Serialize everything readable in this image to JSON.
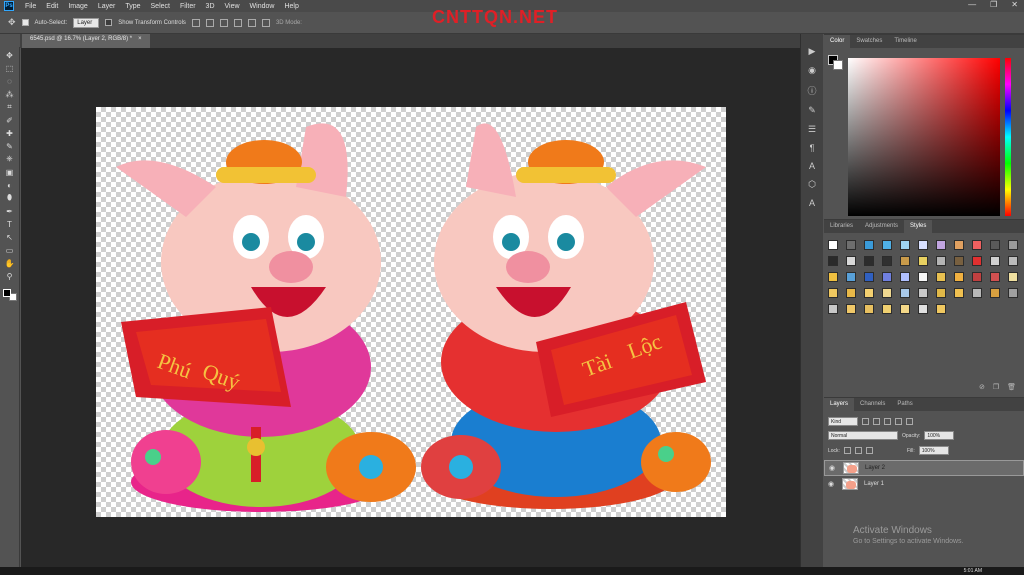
{
  "menu": {
    "logo": "Ps",
    "items": [
      "File",
      "Edit",
      "Image",
      "Layer",
      "Type",
      "Select",
      "Filter",
      "3D",
      "View",
      "Window",
      "Help"
    ],
    "window_controls": [
      "—",
      "❐",
      "✕"
    ]
  },
  "options": {
    "auto_select_label": "Auto-Select:",
    "auto_select_value": "Layer",
    "transform_label": "Show Transform Controls",
    "mode3d": "3D Mode:",
    "watermark": "CNTTQN.NET"
  },
  "doc": {
    "tab_title": "6545.psd @ 16.7% (Layer 2, RGB/8) *",
    "close": "×"
  },
  "tools": [
    "✥",
    "⬚",
    "◌",
    "⁂",
    "⌗",
    "✐",
    "✚",
    "✎",
    "⎈",
    "▣",
    "◐",
    "⬮",
    "✒",
    "T",
    "↖",
    "▭",
    "✋",
    "⚲"
  ],
  "color_panel": {
    "tabs": [
      "Color",
      "Swatches",
      "Timeline"
    ]
  },
  "styles_panel": {
    "tabs": [
      "Libraries",
      "Adjustments",
      "Styles"
    ],
    "swatches": [
      "#ffffff",
      "#6e6e6e",
      "#3a9ad8",
      "#4fb0e6",
      "#9fd3f0",
      "#d8e0ff",
      "#c1a5e0",
      "#e0a060",
      "#f06060",
      "#5a5a5a",
      "#9a9a9a",
      "#2a2a2a",
      "#d8d8d8",
      "#2c2c2c",
      "#303030",
      "#c89a4a",
      "#e8d060",
      "#b4b4b4",
      "#786040",
      "#e03030",
      "#d0d0d0",
      "#bbbbbb",
      "#f0c040",
      "#58a0d8",
      "#3060c0",
      "#7080e0",
      "#b0c0ff",
      "#f6f6f6",
      "#e8c050",
      "#f0b040",
      "#c04040",
      "#d05050",
      "#f0e0a0",
      "#f0c860",
      "#e8b848",
      "#f4d070",
      "#f0d890",
      "#a8c8e8",
      "#c8c8c8",
      "#e0b848",
      "#f0c050",
      "#b8b8b8",
      "#d8a040",
      "#a0a0a0",
      "#c8c8c8",
      "#f0c868",
      "#e8c060",
      "#f0d070",
      "#f4d888",
      "#e0e0e0",
      "#f0c860"
    ]
  },
  "layers_panel": {
    "tabs": [
      "Layers",
      "Channels",
      "Paths"
    ],
    "filter": "Kind",
    "blend_mode": "Normal",
    "opacity_label": "Opacity:",
    "opacity_value": "100%",
    "lock_label": "Lock:",
    "fill_label": "Fill:",
    "fill_value": "100%",
    "layers": [
      {
        "name": "Layer 2",
        "selected": true
      },
      {
        "name": "Layer 1",
        "selected": false
      }
    ]
  },
  "activation": {
    "title": "Activate Windows",
    "subtitle": "Go to Settings to activate Windows."
  },
  "taskbar": {
    "time": "5:01 AM"
  }
}
